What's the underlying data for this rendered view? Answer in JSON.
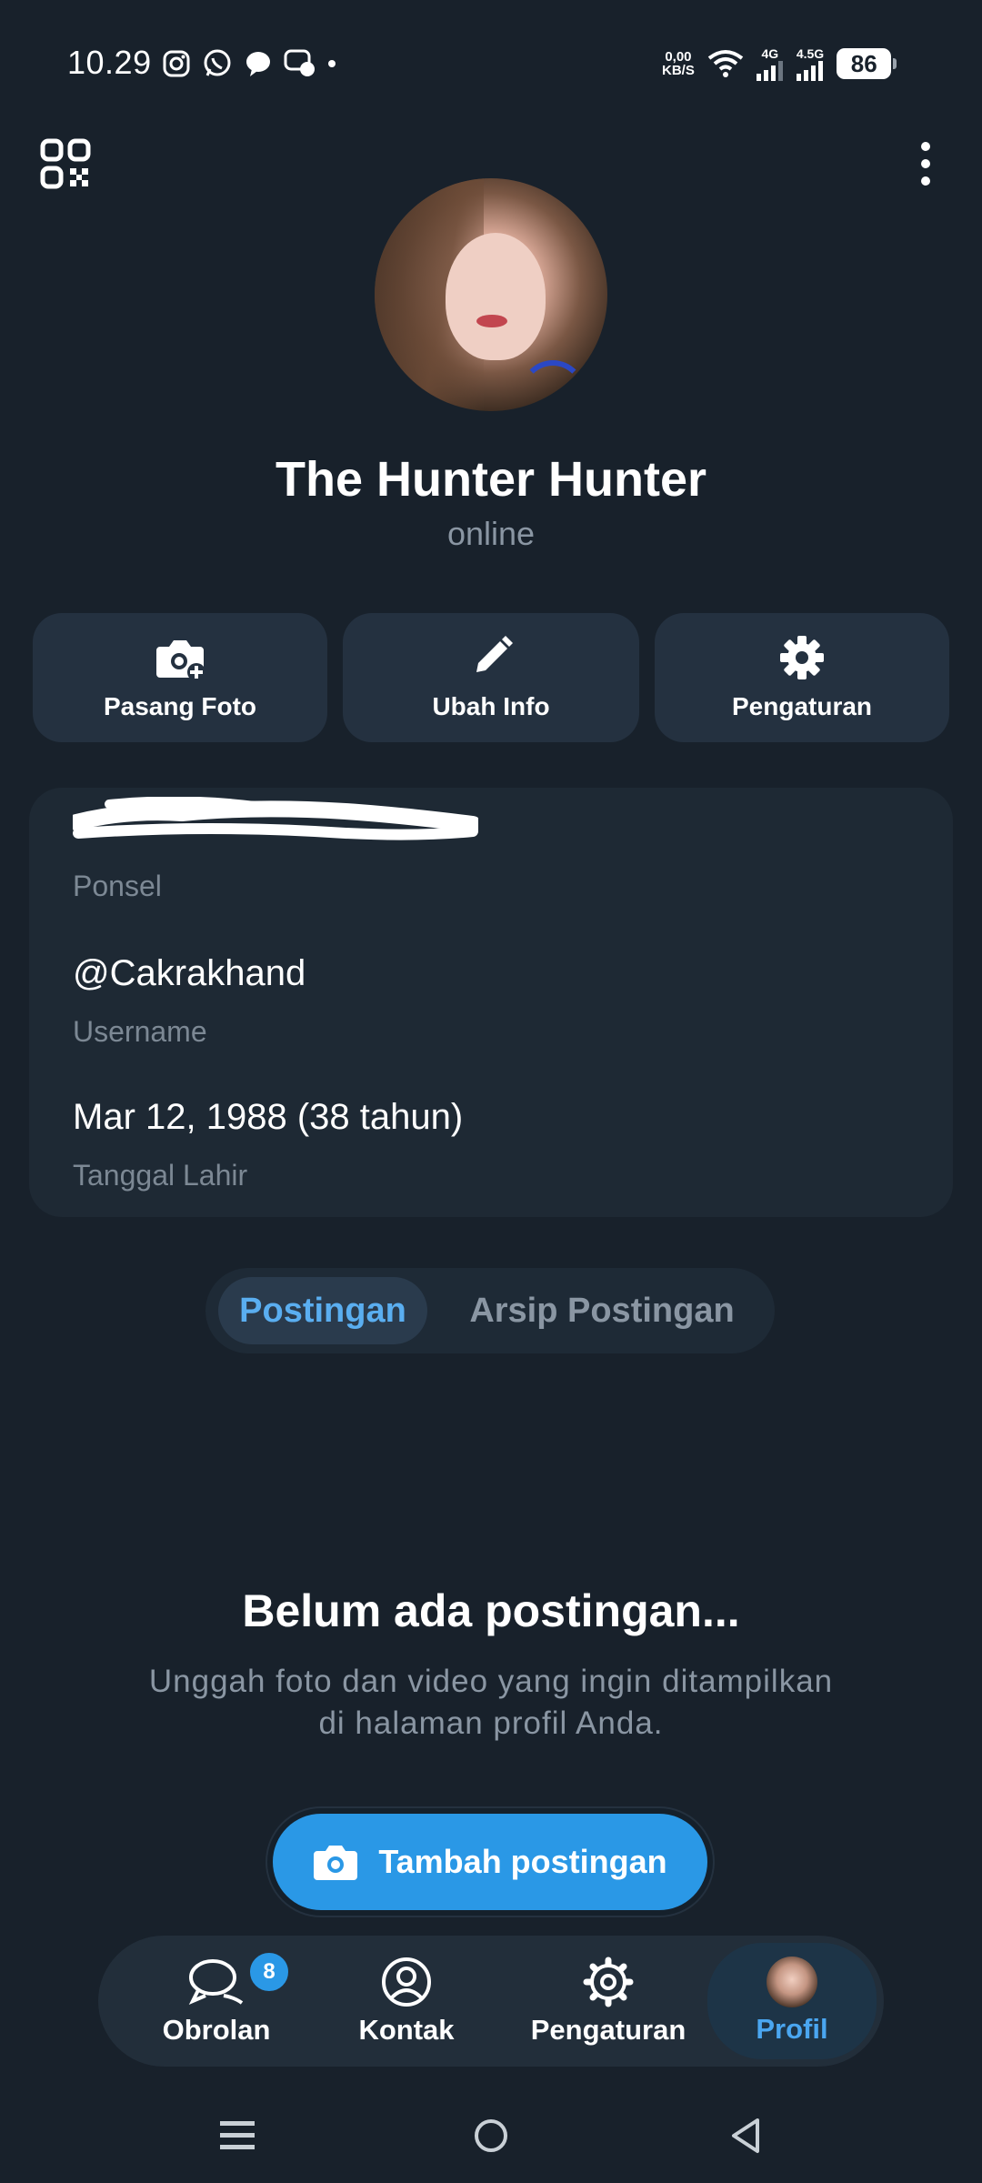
{
  "status_bar": {
    "time": "10.29",
    "net_speed_value": "0,00",
    "net_speed_unit": "KB/S",
    "signal_1": "4G",
    "signal_2": "4.5G",
    "battery": "86"
  },
  "profile": {
    "name": "The Hunter Hunter",
    "status": "online"
  },
  "actions": [
    {
      "label": "Pasang Foto",
      "icon": "camera-add-icon"
    },
    {
      "label": "Ubah Info",
      "icon": "pencil-icon"
    },
    {
      "label": "Pengaturan",
      "icon": "gear-icon"
    }
  ],
  "info": {
    "phone_label": "Ponsel",
    "username_value": "@Cakrakhand",
    "username_label": "Username",
    "birthday_value": "Mar 12, 1988 (38 tahun)",
    "birthday_label": "Tanggal Lahir"
  },
  "tabs": {
    "active": "Postingan",
    "inactive": "Arsip Postingan"
  },
  "empty_state": {
    "title": "Belum ada postingan...",
    "subtitle_line1": "Unggah foto dan video yang ingin ditampilkan",
    "subtitle_line2": "di halaman profil Anda.",
    "button_label": "Tambah postingan"
  },
  "bottom_nav": {
    "items": [
      {
        "label": "Obrolan",
        "icon": "chat-icon",
        "badge": "8"
      },
      {
        "label": "Kontak",
        "icon": "contact-icon"
      },
      {
        "label": "Pengaturan",
        "icon": "gear-icon"
      },
      {
        "label": "Profil",
        "icon": "avatar"
      }
    ]
  },
  "colors": {
    "background": "#18212b",
    "accent": "#2a98e6",
    "card": "#1e2934"
  }
}
